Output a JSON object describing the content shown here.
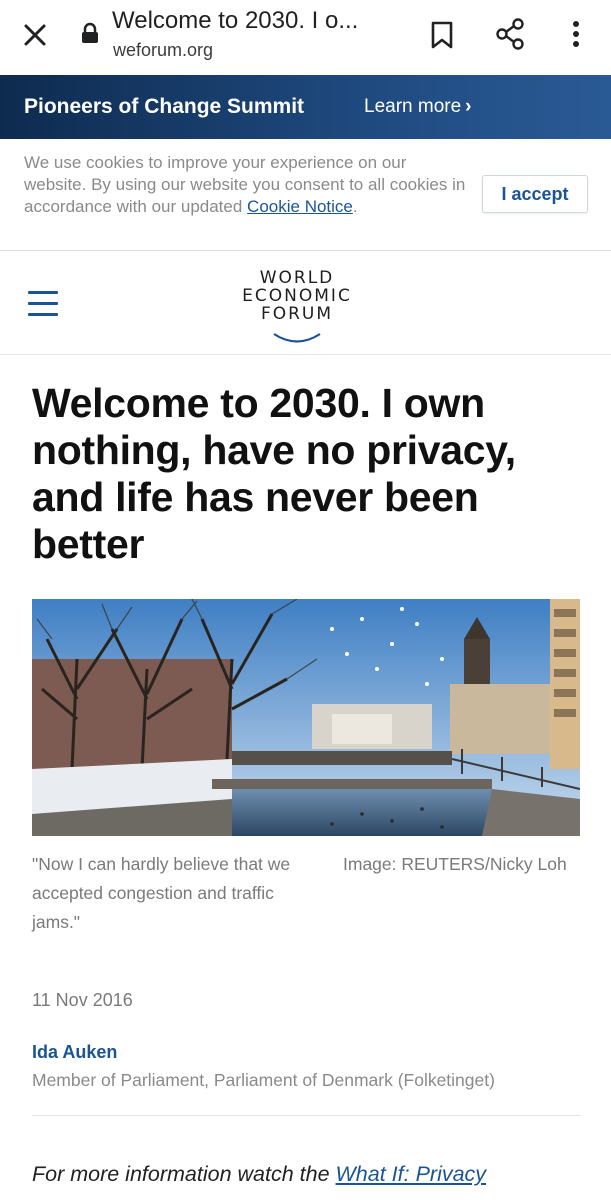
{
  "browser": {
    "page_title": "Welcome to 2030. I o...",
    "domain": "weforum.org",
    "icons": [
      "close-icon",
      "lock-icon",
      "bookmark-icon",
      "share-icon",
      "more-vert-icon"
    ]
  },
  "promo": {
    "title": "Pioneers of Change Summit",
    "link_label": "Learn more",
    "chevron": "›"
  },
  "cookie": {
    "text": "We use cookies to improve your experience on our website. By using our website you consent to all cookies in accordance with our updated ",
    "link_label": "Cookie Notice",
    "trailing": ".",
    "accept_label": "I accept"
  },
  "site": {
    "logo_lines": [
      "WORLD",
      "ECONOMIC",
      "FORUM"
    ]
  },
  "article": {
    "headline": "Welcome to 2030. I own nothing, have no privacy, and life has never been better",
    "caption": "\"Now I can hardly believe that we accepted congestion and traffic jams.\"",
    "image_credit": "Image: REUTERS/Nicky Loh",
    "date": "11 Nov 2016",
    "author": "Ida Auken",
    "author_role": "Member of Parliament, Parliament of Denmark (Folketinget)",
    "more_info_prefix": "For more information watch the ",
    "more_info_link": "What If: Privacy"
  },
  "colors": {
    "brand_blue": "#1b5496",
    "banner_dark": "#0e2b4f",
    "muted_text": "#7a7a7a"
  }
}
